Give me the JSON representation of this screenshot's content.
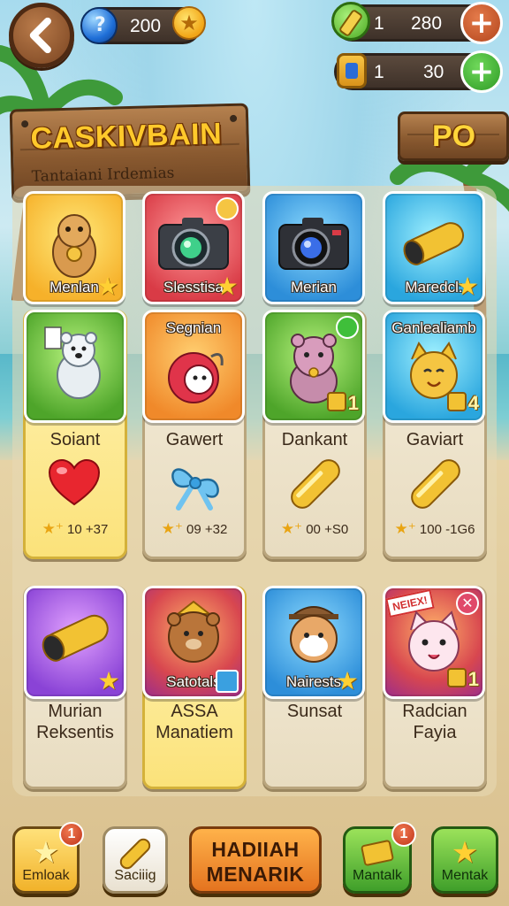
{
  "header": {
    "coins": "200",
    "energy_count": "1",
    "energy_value": "280",
    "ticket_count": "1",
    "ticket_value": "30"
  },
  "title_sign": {
    "title": "CASKIVBAIN",
    "subtitle": "Tantaiani Irdemias"
  },
  "side_sign": {
    "label": "PO"
  },
  "row1_cards": [
    {
      "label": "Menlan",
      "color": "yellow",
      "art": "hamster-icon"
    },
    {
      "label": "Slesstisa",
      "color": "red",
      "art": "camera-icon"
    },
    {
      "label": "Merian",
      "color": "blue",
      "art": "camera-icon"
    },
    {
      "label": "Maredcl:",
      "color": "cyan",
      "art": "gold-capsule-icon"
    }
  ],
  "row2_cards": [
    {
      "top_label": "",
      "color": "green",
      "art": "polar-bear-icon",
      "level": ""
    },
    {
      "top_label": "Segnian",
      "color": "orange",
      "art": "robot-ball-icon",
      "level": ""
    },
    {
      "top_label": "",
      "color": "green",
      "art": "pink-hamster-icon",
      "level": "1"
    },
    {
      "top_label": "Ganlealiamb",
      "color": "cyan",
      "art": "yellow-cat-icon",
      "level": "4"
    }
  ],
  "row2_rewards": [
    {
      "name": "Soiant",
      "item": "heart-icon",
      "price": "10",
      "price_alt": "+37"
    },
    {
      "name": "Gawert",
      "item": "bow-icon",
      "price": "09",
      "price_alt": "+32"
    },
    {
      "name": "Dankant",
      "item": "gold-bar-icon",
      "price": "00",
      "price_alt": "+S0"
    },
    {
      "name": "Gaviart",
      "item": "gold-bar-icon",
      "price": "100",
      "price_alt": "-1G6"
    }
  ],
  "row3_cards": [
    {
      "label": "",
      "color": "purple",
      "art": "gold-capsule-icon"
    },
    {
      "label": "Satotals",
      "color": "magenta",
      "art": "brown-bear-icon"
    },
    {
      "label": "Nairests",
      "color": "blue",
      "art": "explorer-hamster-icon"
    },
    {
      "label": "",
      "color": "magenta",
      "art": "white-cat-icon",
      "level": "1",
      "tag": "NEIEX!"
    }
  ],
  "row3_names": [
    [
      "Murian",
      "Reksentis"
    ],
    [
      "ASSA",
      "Manatiem"
    ],
    [
      "Sunsat",
      ""
    ],
    [
      "Radcian",
      "Fayia"
    ]
  ],
  "bottom_bar": {
    "btn1": {
      "label": "Emloak",
      "badge": "1"
    },
    "btn2": {
      "label": "Saciiig"
    },
    "big": {
      "line1": "HADIIAH",
      "line2": "MENARIK"
    },
    "btn4": {
      "label": "Mantalk",
      "badge": "1"
    },
    "btn5": {
      "label": "Mentak"
    }
  }
}
